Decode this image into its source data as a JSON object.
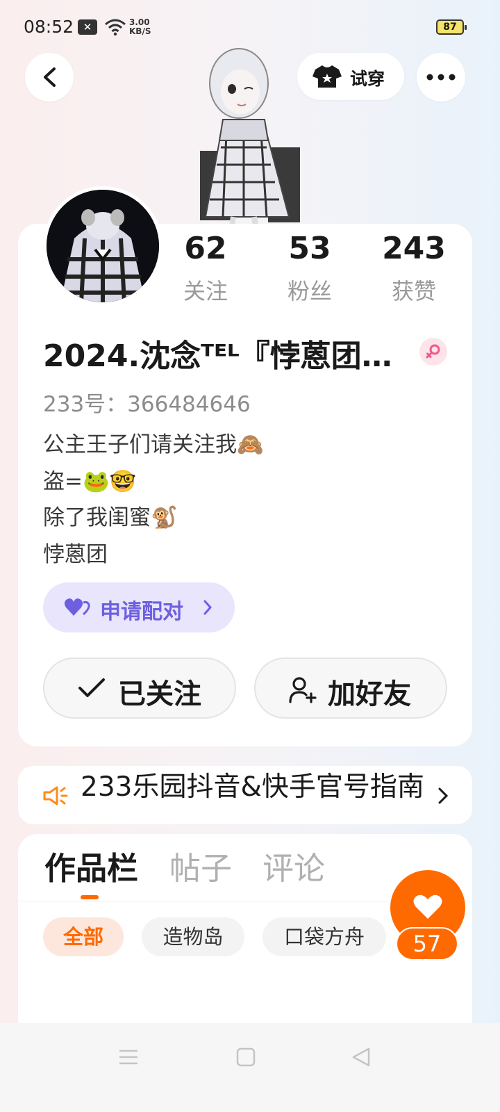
{
  "status_bar": {
    "time": "08:52",
    "network_speed_value": "3.00",
    "network_speed_unit": "KB/S",
    "battery": "87",
    "icons": [
      "notification-x-icon",
      "wifi-icon",
      "battery-icon"
    ]
  },
  "header": {
    "tryon_label": "试穿",
    "icons": [
      "back-arrow-icon",
      "tshirt-icon",
      "more-dots-icon"
    ]
  },
  "profile": {
    "stats": [
      {
        "value": "62",
        "label": "关注"
      },
      {
        "value": "53",
        "label": "粉丝"
      },
      {
        "value": "243",
        "label": "获赞"
      }
    ],
    "nickname": "2024.沈念ᵀᴱᴸ『悖蒽团…",
    "gender": "female",
    "user_id": "233号：366484646",
    "bio": [
      "公主王子们请关注我🙈",
      "盗=🐸🤓",
      "除了我闺蜜🐒",
      "悖蒽团"
    ],
    "match_label": "申请配对",
    "follow_label": "已关注",
    "add_friend_label": "加好友"
  },
  "announcement": {
    "text": "233乐园抖音&快手官号指南"
  },
  "tabs": {
    "items": [
      "作品栏",
      "帖子",
      "评论"
    ],
    "active": "作品栏",
    "filters": [
      "全部",
      "造物岛",
      "口袋方舟"
    ],
    "active_filter": "全部"
  },
  "like_fab": {
    "count": "57"
  },
  "colors": {
    "accent": "#ff6a00",
    "match_purple": "#6d5fe0",
    "match_bg": "#e8e5fc"
  }
}
